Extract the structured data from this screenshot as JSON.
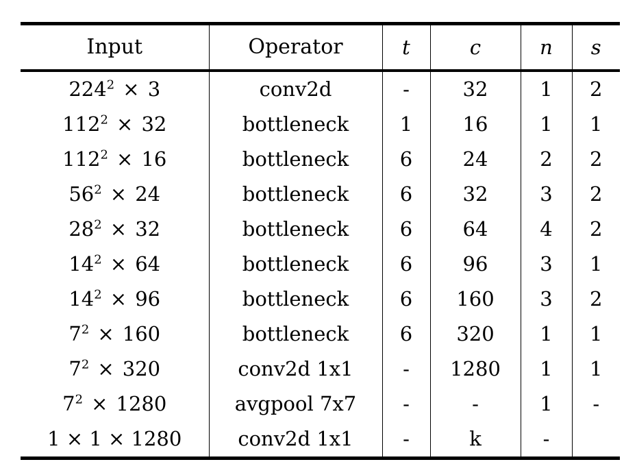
{
  "table": {
    "caption_present": false,
    "columns": [
      {
        "key": "input",
        "label": "Input",
        "style": "roman"
      },
      {
        "key": "operator",
        "label": "Operator",
        "style": "roman"
      },
      {
        "key": "t",
        "label": "t",
        "style": "italic"
      },
      {
        "key": "c",
        "label": "c",
        "style": "italic"
      },
      {
        "key": "n",
        "label": "n",
        "style": "italic"
      },
      {
        "key": "s",
        "label": "s",
        "style": "italic"
      }
    ],
    "rows": [
      {
        "input_base": "224",
        "input_exp": "2",
        "input_tail": "3",
        "input_text": "224² × 3",
        "operator": "conv2d",
        "t": "-",
        "c": "32",
        "n": "1",
        "s": "2"
      },
      {
        "input_base": "112",
        "input_exp": "2",
        "input_tail": "32",
        "input_text": "112² × 32",
        "operator": "bottleneck",
        "t": "1",
        "c": "16",
        "n": "1",
        "s": "1"
      },
      {
        "input_base": "112",
        "input_exp": "2",
        "input_tail": "16",
        "input_text": "112² × 16",
        "operator": "bottleneck",
        "t": "6",
        "c": "24",
        "n": "2",
        "s": "2"
      },
      {
        "input_base": "56",
        "input_exp": "2",
        "input_tail": "24",
        "input_text": "56² × 24",
        "operator": "bottleneck",
        "t": "6",
        "c": "32",
        "n": "3",
        "s": "2"
      },
      {
        "input_base": "28",
        "input_exp": "2",
        "input_tail": "32",
        "input_text": "28² × 32",
        "operator": "bottleneck",
        "t": "6",
        "c": "64",
        "n": "4",
        "s": "2"
      },
      {
        "input_base": "14",
        "input_exp": "2",
        "input_tail": "64",
        "input_text": "14² × 64",
        "operator": "bottleneck",
        "t": "6",
        "c": "96",
        "n": "3",
        "s": "1"
      },
      {
        "input_base": "14",
        "input_exp": "2",
        "input_tail": "96",
        "input_text": "14² × 96",
        "operator": "bottleneck",
        "t": "6",
        "c": "160",
        "n": "3",
        "s": "2"
      },
      {
        "input_base": "7",
        "input_exp": "2",
        "input_tail": "160",
        "input_text": "7² × 160",
        "operator": "bottleneck",
        "t": "6",
        "c": "320",
        "n": "1",
        "s": "1"
      },
      {
        "input_base": "7",
        "input_exp": "2",
        "input_tail": "320",
        "input_text": "7² × 320",
        "operator": "conv2d 1x1",
        "t": "-",
        "c": "1280",
        "n": "1",
        "s": "1"
      },
      {
        "input_base": "7",
        "input_exp": "2",
        "input_tail": "1280",
        "input_text": "7² × 1280",
        "operator": "avgpool 7x7",
        "t": "-",
        "c": "-",
        "n": "1",
        "s": "-"
      },
      {
        "input_base": "1",
        "input_exp": "",
        "input_tail": "1 × 1280",
        "input_text": "1 × 1 × 1280",
        "operator": "conv2d 1x1",
        "t": "-",
        "c": "k",
        "n": "-",
        "s": ""
      }
    ]
  },
  "style": {
    "rule_color": "#000000",
    "text_color": "#000000",
    "background": "#ffffff",
    "separator_color": "#000000"
  }
}
